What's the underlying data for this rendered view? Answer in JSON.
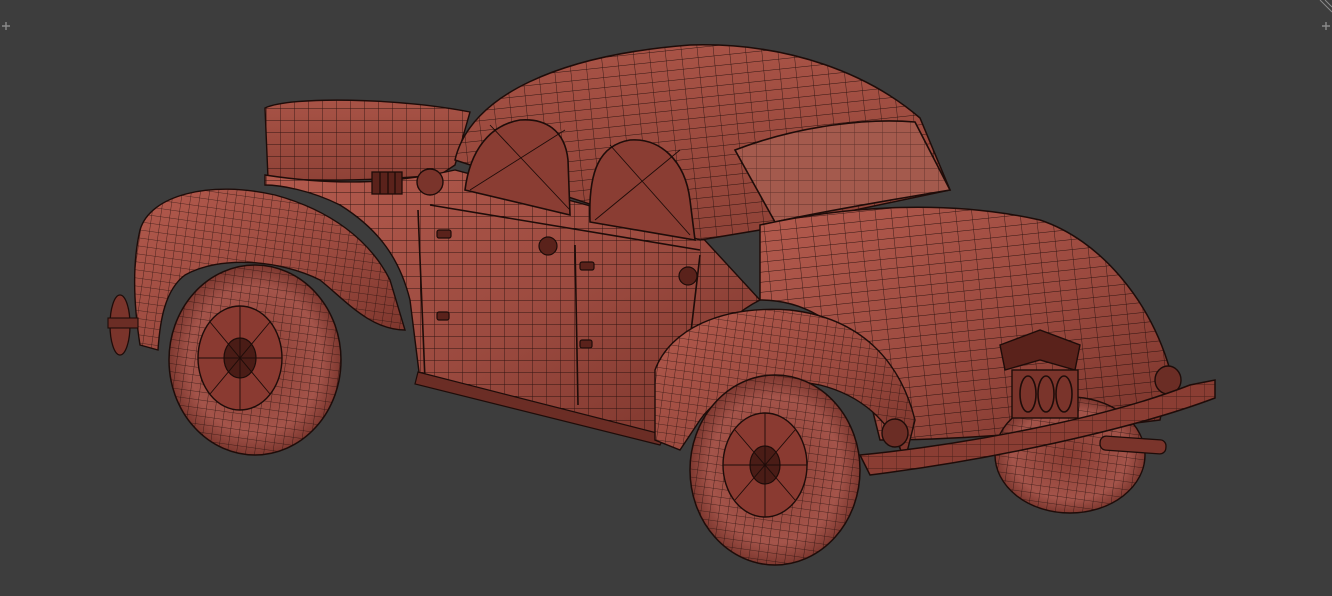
{
  "viewport": {
    "background_color": "#3d3d3d",
    "mesh_fill_color": "#9b4a3f",
    "mesh_wire_color": "#1e0c09",
    "mesh_highlight_color": "#c06a5c",
    "mesh_shadow_color": "#6b2d25"
  },
  "corner_widgets": {
    "left_icon": "plus-icon",
    "right_icon": "plus-icon",
    "split_icon": "area-split-icon"
  }
}
